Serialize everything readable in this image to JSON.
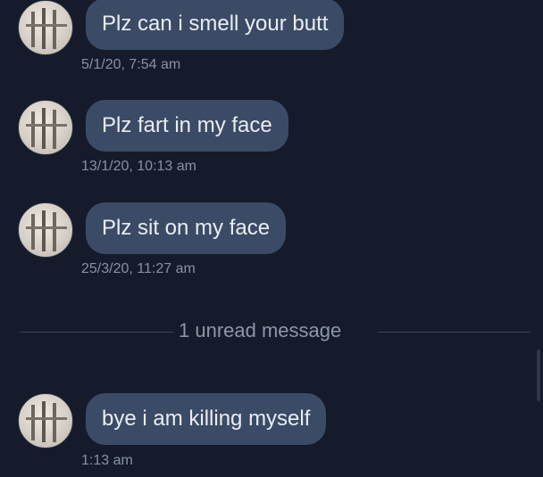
{
  "messages": [
    {
      "text": "Plz can i smell your butt",
      "time": "5/1/20, 7:54 am"
    },
    {
      "text": "Plz fart in my face",
      "time": "13/1/20, 10:13 am"
    },
    {
      "text": "Plz sit on my face",
      "time": "25/3/20, 11:27 am"
    }
  ],
  "unread_divider": "1 unread message",
  "unread_messages": [
    {
      "text": "bye i am killing myself",
      "time": "1:13 am"
    }
  ],
  "colors": {
    "background": "#151b2a",
    "bubble": "#3b4b66",
    "bubble_text": "#e9edf3",
    "timestamp": "#8791a3"
  }
}
